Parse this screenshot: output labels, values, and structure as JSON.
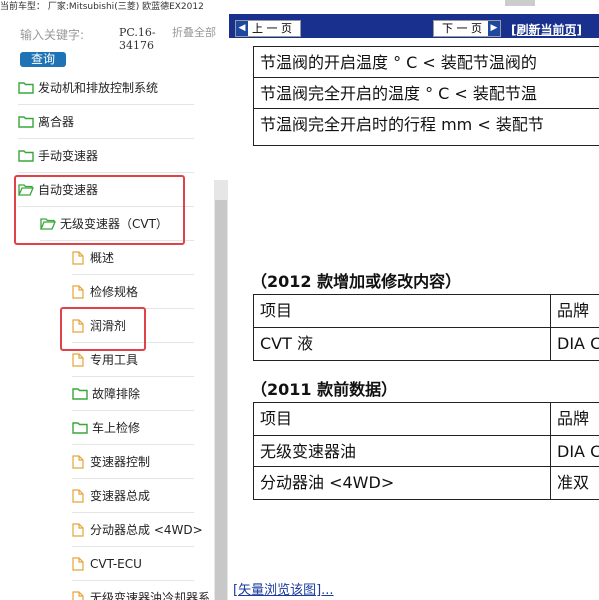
{
  "header": {
    "current_model_label": "当前车型：  厂家:Mitsubishi(三菱) 欧蓝德EX2012"
  },
  "search": {
    "hint": "输入关键字:",
    "button": "查询",
    "pc_code": "PC.16-34176",
    "fold_all": "折叠全部"
  },
  "tree": {
    "items": [
      {
        "label": "发动机和排放控制系统",
        "icon": "folder-icon"
      },
      {
        "label": "离合器",
        "icon": "folder-icon"
      },
      {
        "label": "手动变速器",
        "icon": "folder-icon"
      },
      {
        "label": "自动变速器",
        "icon": "folder-open-icon"
      },
      {
        "label": "无级变速器（CVT）",
        "icon": "folder-open-icon"
      },
      {
        "label": "概述",
        "icon": "document-icon"
      },
      {
        "label": "检修规格",
        "icon": "document-icon"
      },
      {
        "label": "润滑剂",
        "icon": "document-icon"
      },
      {
        "label": "专用工具",
        "icon": "document-icon"
      },
      {
        "label": "故障排除",
        "icon": "folder-icon"
      },
      {
        "label": "车上检修",
        "icon": "folder-icon"
      },
      {
        "label": "变速器控制",
        "icon": "document-icon"
      },
      {
        "label": "变速器总成",
        "icon": "document-icon"
      },
      {
        "label": "分动器总成 <4WD>",
        "icon": "document-icon"
      },
      {
        "label": "CVT-ECU",
        "icon": "document-icon"
      },
      {
        "label": "无级变速器油冷却器系",
        "icon": "document-icon"
      }
    ]
  },
  "nav": {
    "prev": "上 一 页",
    "next": "下 一 页",
    "refresh": "[刷新当前页]"
  },
  "doc": {
    "top_rows": [
      "节温阀的开启温度 ° C < 装配节温阀的",
      "节温阀完全开启的温度 ° C < 装配节温",
      "节温阀完全开启时的行程 mm < 装配节"
    ],
    "section_2012": "（2012 款增加或修改内容）",
    "table_2012": [
      [
        "项目",
        "品牌"
      ],
      [
        "CVT 液",
        "DIA C"
      ]
    ],
    "section_2011": "（2011 款前数据）",
    "table_2011": [
      [
        "项目",
        "品牌"
      ],
      [
        "无级变速器油",
        "DIA C"
      ],
      [
        "分动器油 <4WD>",
        "准双"
      ]
    ]
  },
  "bottom_link": "[矢量浏览该图]...",
  "colors": {
    "nav_bar": "#19308f",
    "highlight": "#e0424a",
    "search_button": "#1d73b5",
    "folder": "#3aa63a",
    "document": "#e8a33a"
  }
}
